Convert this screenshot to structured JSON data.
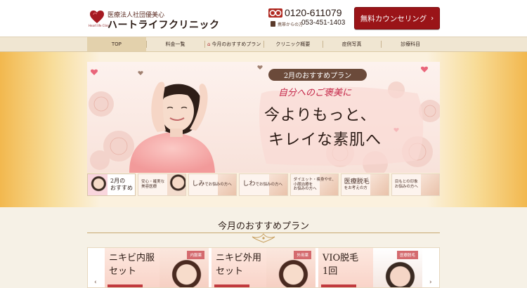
{
  "header": {
    "logo_sub": "Heart life Clinic",
    "org": "医療法人社団優美心",
    "clinic_name": "ハートライフクリニック",
    "phone_main": "0120-611079",
    "phone_sub_label": "携帯からの方",
    "phone_sub": "053-451-1403",
    "cta_label": "無料カウンセリング",
    "cta_arrow": "›"
  },
  "nav": {
    "items": [
      {
        "label": "TOP"
      },
      {
        "label": "料金一覧"
      },
      {
        "label": "今月のおすすめプラン"
      },
      {
        "label": "クリニック概要"
      },
      {
        "label": "症例写真"
      },
      {
        "label": "診療科目"
      }
    ],
    "active_index": 0
  },
  "banner": {
    "pill": "2月のおすすめプラン",
    "script": "自分へのご褒美に",
    "headline_1": "今よりもっと、",
    "headline_2": "キレイな素肌へ"
  },
  "thumbs": [
    {
      "title": "2月の",
      "sub": "おすすめ"
    },
    {
      "title": "",
      "sub": "安心・確実な\n美容医療"
    },
    {
      "title": "しみ",
      "sub": "でお悩みの方へ"
    },
    {
      "title": "しわ",
      "sub": "でお悩みの方へ"
    },
    {
      "title": "",
      "sub": "ダイエット・痩身やせ、\n小顔治療を\nお悩みの方へ"
    },
    {
      "title": "医療脱毛",
      "sub": "をお考えの方"
    },
    {
      "title": "目もとの印象",
      "sub": "お悩みの方へ"
    }
  ],
  "section": {
    "title": "今月のおすすめプラン"
  },
  "carousel": {
    "prev": "‹",
    "next": "›",
    "cards": [
      {
        "title": "ニキビ内服\nセット",
        "badge": "内服薬"
      },
      {
        "title": "ニキビ外用\nセット",
        "badge": "外用薬"
      },
      {
        "title": "VIO脱毛\n1回",
        "badge": "医療脱毛"
      }
    ]
  },
  "colors": {
    "brand_red": "#9a1418",
    "nav_bg": "#f0e6d2",
    "hero_orange": "#f2b84e",
    "accent_pink": "#c5294a"
  }
}
